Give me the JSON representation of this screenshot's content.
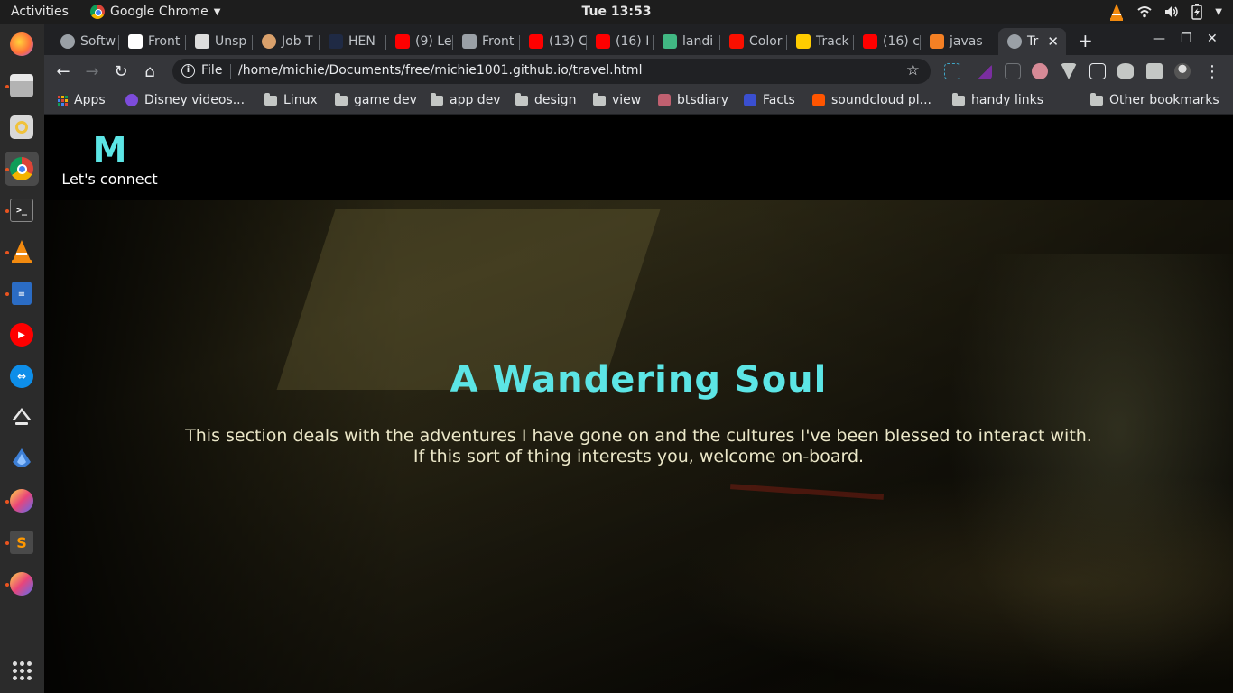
{
  "system": {
    "activities": "Activities",
    "app_name": "Google Chrome",
    "clock": "Tue 13:53"
  },
  "dock": {
    "items": [
      {
        "name": "firefox",
        "color": "#ff7139"
      },
      {
        "name": "files",
        "color": "#c9c9c9"
      },
      {
        "name": "rhythmbox",
        "color": "#f0c23b"
      },
      {
        "name": "chrome",
        "color": "#4285f4"
      },
      {
        "name": "terminal",
        "color": "#333333"
      },
      {
        "name": "vlc",
        "color": "#f28a0f"
      },
      {
        "name": "writer",
        "color": "#2b6cc4"
      },
      {
        "name": "youtube-music",
        "color": "#ff0000"
      },
      {
        "name": "teamviewer",
        "color": "#0e8ee9"
      },
      {
        "name": "inkscape",
        "color": "#555555"
      },
      {
        "name": "app",
        "color": "#3d7fd6"
      },
      {
        "name": "krita",
        "color": "#7b5cd6"
      },
      {
        "name": "sublime-text",
        "color": "#ff9800"
      },
      {
        "name": "krita-2",
        "color": "#7b5cd6"
      }
    ]
  },
  "browser": {
    "tabs": [
      {
        "label": "Softw",
        "favicon_color": "#9aa0a6"
      },
      {
        "label": "Front",
        "favicon_color": "#ffffff"
      },
      {
        "label": "Unsp",
        "favicon_color": "#dddddd"
      },
      {
        "label": "Job T",
        "favicon_color": "#d9a06b"
      },
      {
        "label": "HEN",
        "favicon_color": "#1f2a44"
      },
      {
        "label": "(9) Le",
        "favicon_color": "#ff0000"
      },
      {
        "label": "Front",
        "favicon_color": "#9aa0a6"
      },
      {
        "label": "(13) C",
        "favicon_color": "#ff0000"
      },
      {
        "label": "(16) I",
        "favicon_color": "#ff0000"
      },
      {
        "label": "landi",
        "favicon_color": "#41b883"
      },
      {
        "label": "Color",
        "favicon_color": "#fa0f00"
      },
      {
        "label": "Track",
        "favicon_color": "#ffcc00"
      },
      {
        "label": "(16) c",
        "favicon_color": "#ff0000"
      },
      {
        "label": "javas",
        "favicon_color": "#f48024"
      },
      {
        "label": "Tr",
        "favicon_color": "#9aa0a6"
      }
    ],
    "address": {
      "scheme_label": "File",
      "url": "/home/michie/Documents/free/michie1001.github.io/travel.html"
    },
    "bookmarks": [
      {
        "label": "Apps",
        "type": "apps"
      },
      {
        "label": "Disney videos...",
        "type": "icon",
        "color": "#7d4cdb"
      },
      {
        "label": "Linux",
        "type": "folder"
      },
      {
        "label": "game dev",
        "type": "folder"
      },
      {
        "label": "app dev",
        "type": "folder"
      },
      {
        "label": "design",
        "type": "folder"
      },
      {
        "label": "view",
        "type": "folder"
      },
      {
        "label": "btsdiary",
        "type": "icon",
        "color": "#c06070"
      },
      {
        "label": "Facts",
        "type": "icon",
        "color": "#3a4fd0"
      },
      {
        "label": "soundcloud pl...",
        "type": "icon",
        "color": "#ff5500"
      },
      {
        "label": "handy links",
        "type": "folder"
      }
    ],
    "other_bookmarks": "Other bookmarks"
  },
  "site": {
    "logo": "M",
    "connect": "Let's connect",
    "hero_title": "A Wandering Soul",
    "hero_line1": "This section deals with the adventures I have gone on and the cultures I've been blessed to interact with.",
    "hero_line2": "If this sort of thing interests you, welcome on-board."
  },
  "colors": {
    "accent": "#5ce5e5",
    "hero_text": "#ebe7c8"
  }
}
